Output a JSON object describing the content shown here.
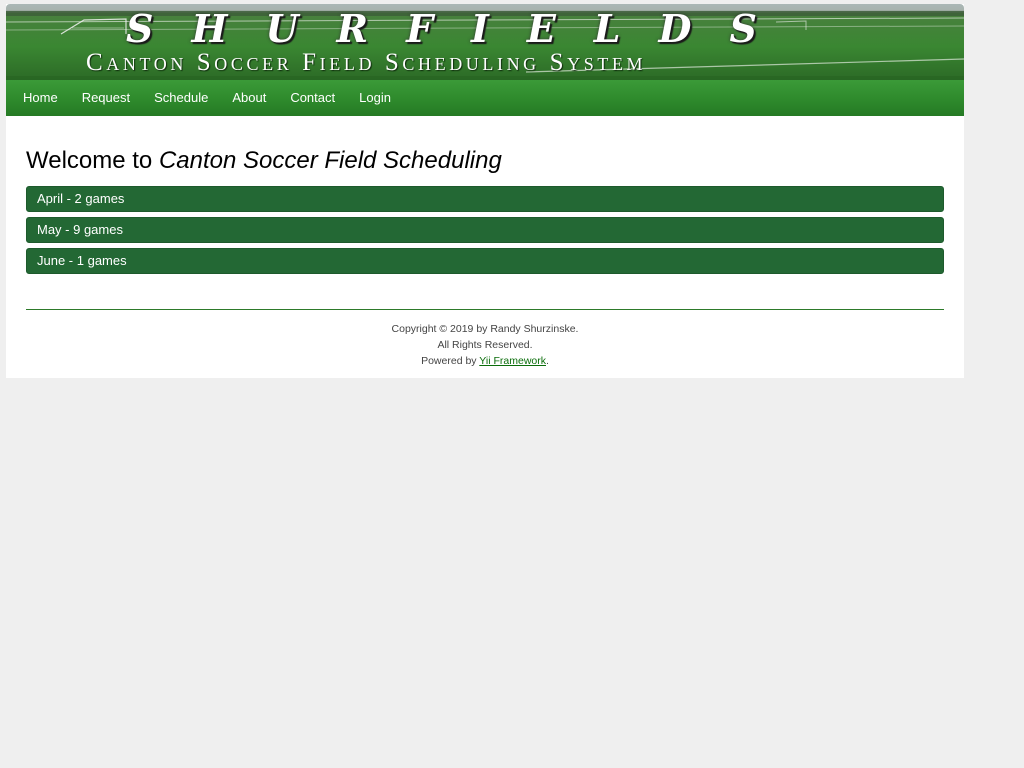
{
  "banner": {
    "title": "ShurFields",
    "subtitle": "Canton Soccer Field Scheduling System"
  },
  "nav": {
    "items": [
      {
        "label": "Home"
      },
      {
        "label": "Request"
      },
      {
        "label": "Schedule"
      },
      {
        "label": "About"
      },
      {
        "label": "Contact"
      },
      {
        "label": "Login"
      }
    ]
  },
  "main": {
    "heading_prefix": "Welcome to ",
    "heading_italic": "Canton Soccer Field Scheduling",
    "months": [
      {
        "label": "April - 2 games"
      },
      {
        "label": "May - 9 games"
      },
      {
        "label": "June - 1 games"
      }
    ]
  },
  "footer": {
    "copyright": "Copyright © 2019 by Randy Shurzinske.",
    "rights": "All Rights Reserved.",
    "powered_prefix": "Powered by ",
    "powered_link": "Yii Framework",
    "powered_suffix": "."
  },
  "colors": {
    "nav_green": "#2e8a2c",
    "bar_green": "#236834",
    "footer_rule": "#2d7a2a",
    "page_bg": "#efefef"
  }
}
